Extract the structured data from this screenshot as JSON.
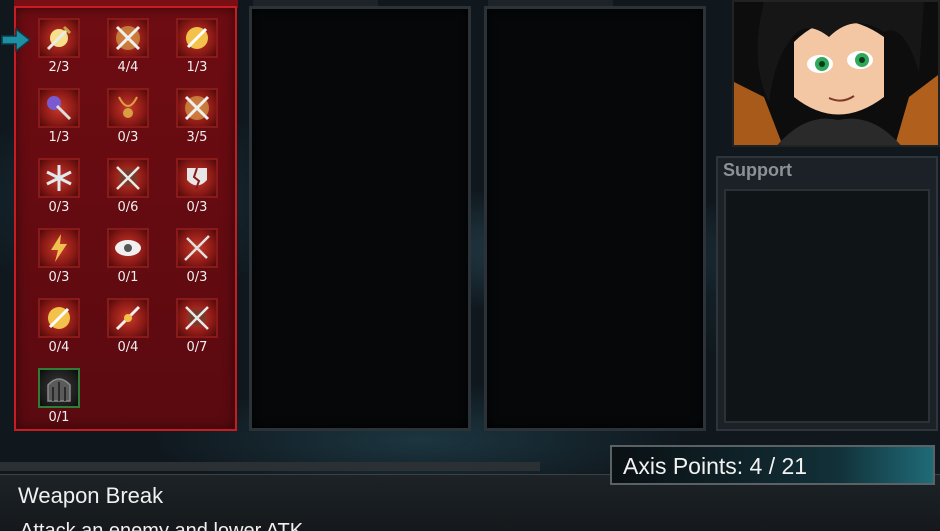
{
  "skills": [
    {
      "id": "s1",
      "icon": "sword-burst-icon",
      "count": "2/3",
      "selected": true
    },
    {
      "id": "s2",
      "icon": "crossed-swords-icon",
      "count": "4/4"
    },
    {
      "id": "s3",
      "icon": "sword-sun-icon",
      "count": "1/3"
    },
    {
      "id": "s4",
      "icon": "mace-icon",
      "count": "1/3"
    },
    {
      "id": "s5",
      "icon": "amulet-icon",
      "count": "0/3"
    },
    {
      "id": "s6",
      "icon": "crossed-swords-icon",
      "count": "3/5"
    },
    {
      "id": "s7",
      "icon": "snowflake-icon",
      "count": "0/3"
    },
    {
      "id": "s8",
      "icon": "crossed-swords-shield-icon",
      "count": "0/6"
    },
    {
      "id": "s9",
      "icon": "broken-shield-icon",
      "count": "0/3"
    },
    {
      "id": "s10",
      "icon": "lightning-icon",
      "count": "0/3"
    },
    {
      "id": "s11",
      "icon": "eye-icon",
      "count": "0/1"
    },
    {
      "id": "s12",
      "icon": "spear-icon",
      "count": "0/3"
    },
    {
      "id": "s13",
      "icon": "sword-sun-icon",
      "count": "0/4"
    },
    {
      "id": "s14",
      "icon": "broken-sword-icon",
      "count": "0/4"
    },
    {
      "id": "s15",
      "icon": "crossed-swords-shield-icon",
      "count": "0/7"
    },
    {
      "id": "s16",
      "icon": "gate-icon",
      "count": "0/1",
      "gate": true
    }
  ],
  "support": {
    "title": "Support"
  },
  "axis_points": {
    "label": "Axis Points: 4 / 21"
  },
  "description": {
    "skill_name": "Weapon Break",
    "text": "Attack an enemy and lower ATK"
  },
  "colors": {
    "skills_panel": "#6e0c12",
    "skills_border": "#c81c24",
    "axis_glow": "#1f6b78"
  }
}
